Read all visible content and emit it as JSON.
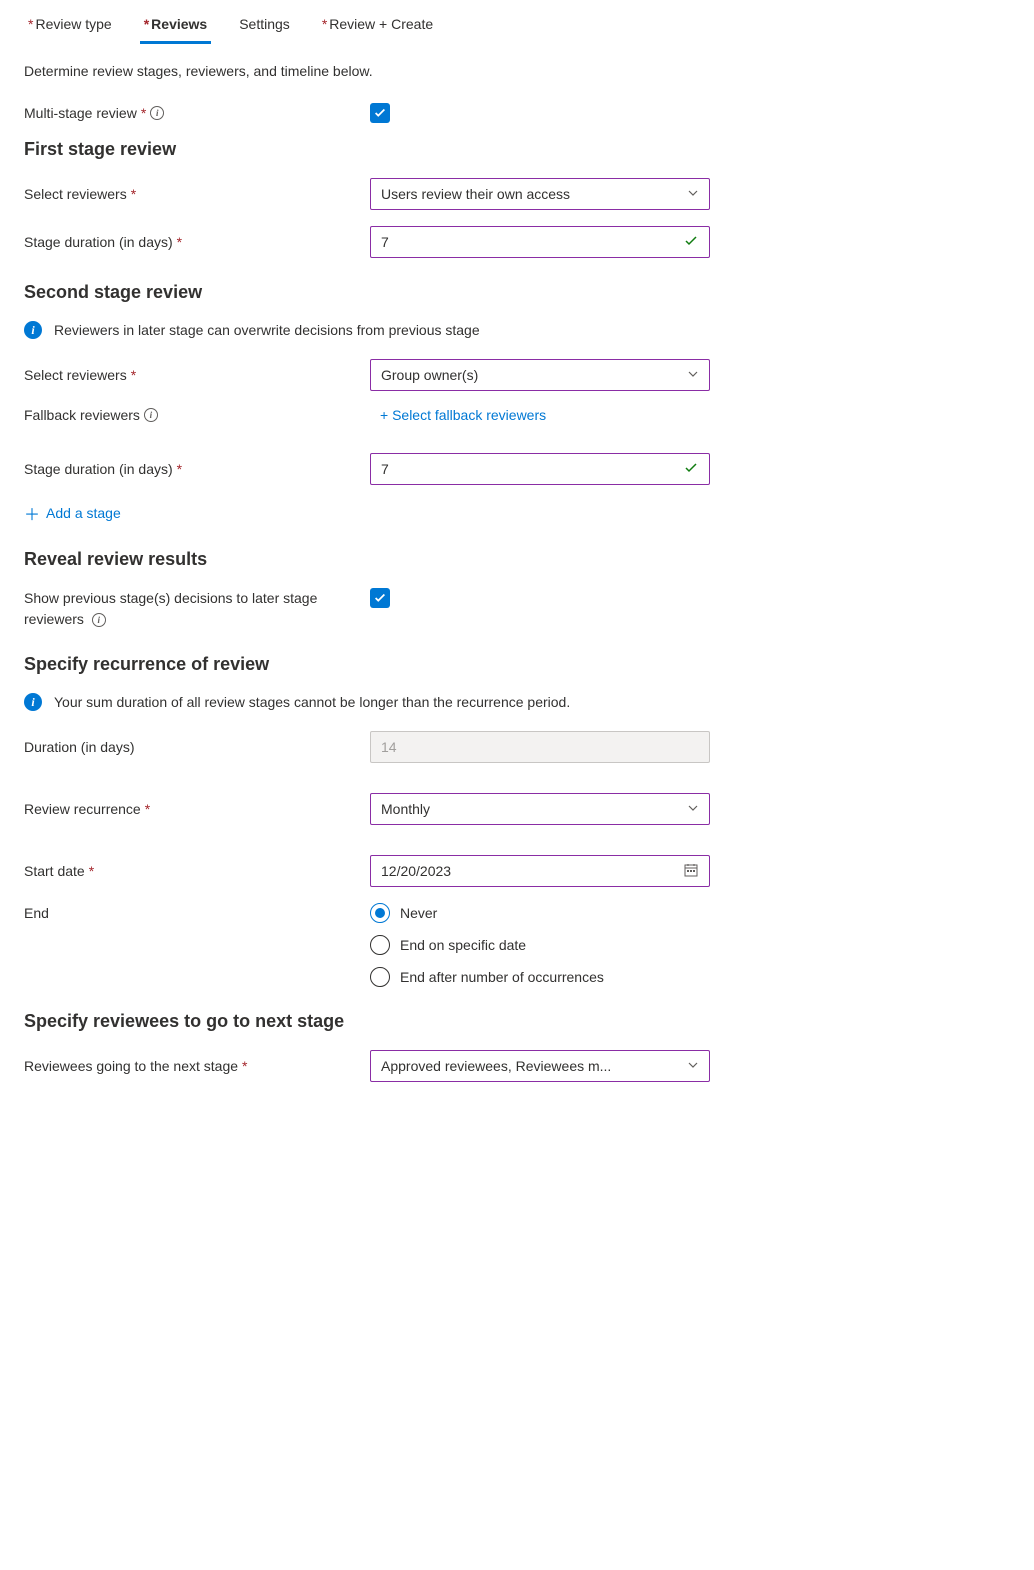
{
  "tabs": {
    "review_type": "Review type",
    "reviews": "Reviews",
    "settings": "Settings",
    "review_create": "Review + Create"
  },
  "intro": "Determine review stages, reviewers, and timeline below.",
  "multi_stage": {
    "label": "Multi-stage review"
  },
  "first_stage": {
    "heading": "First stage review",
    "select_reviewers_label": "Select reviewers",
    "select_reviewers_value": "Users review their own access",
    "stage_duration_label": "Stage duration (in days)",
    "stage_duration_value": "7"
  },
  "second_stage": {
    "heading": "Second stage review",
    "info": "Reviewers in later stage can overwrite decisions from previous stage",
    "select_reviewers_label": "Select reviewers",
    "select_reviewers_value": "Group owner(s)",
    "fallback_label": "Fallback reviewers",
    "fallback_link": "+ Select fallback reviewers",
    "stage_duration_label": "Stage duration (in days)",
    "stage_duration_value": "7"
  },
  "add_stage": "Add a stage",
  "reveal": {
    "heading": "Reveal review results",
    "label": "Show previous stage(s) decisions to later stage reviewers"
  },
  "recurrence": {
    "heading": "Specify recurrence of review",
    "info": "Your sum duration of all review stages cannot be longer than the recurrence period.",
    "duration_label": "Duration (in days)",
    "duration_value": "14",
    "recurrence_label": "Review recurrence",
    "recurrence_value": "Monthly",
    "start_label": "Start date",
    "start_value": "12/20/2023",
    "end_label": "End",
    "end_never": "Never",
    "end_specific": "End on specific date",
    "end_occurrences": "End after number of occurrences"
  },
  "next_stage": {
    "heading": "Specify reviewees to go to next stage",
    "label": "Reviewees going to the next stage",
    "value": "Approved reviewees, Reviewees m..."
  }
}
